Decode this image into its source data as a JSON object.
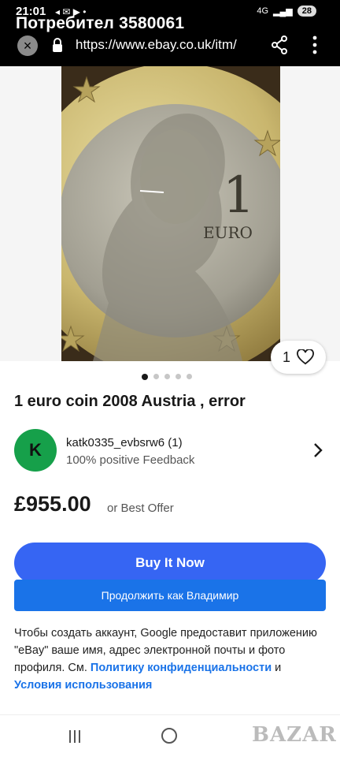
{
  "status_bar": {
    "time": "21:01",
    "battery": "28",
    "network": "4G"
  },
  "browser": {
    "page_title": "Потребител 3580061",
    "url": "https://www.ebay.co.uk/itm/"
  },
  "gallery": {
    "like_count": "1",
    "total_images": 5,
    "active_index": 0,
    "coin_text": "EURO"
  },
  "item": {
    "title": "1 euro coin 2008 Austria , error"
  },
  "seller": {
    "avatar_letter": "K",
    "name": "katk0335_evbsrw6 (1)",
    "feedback": "100% positive Feedback"
  },
  "price": {
    "amount": "£955.00",
    "offer_text": "or Best Offer"
  },
  "buttons": {
    "buy_now": "Buy It Now",
    "google_continue": "Продолжить как Владимир"
  },
  "consent": {
    "text_before": "Чтобы создать аккаунт, Google предоставит приложению \"eBay\" ваше имя, адрес электронной почты и фото профиля. См.",
    "privacy_link": "Политику конфиденциальности",
    "and_text": "и",
    "terms_link": "Условия использования"
  },
  "watermark": "BAZAR",
  "colors": {
    "buy_now": "#3665f3",
    "google_button": "#1a73e8",
    "avatar": "#16a04a"
  }
}
